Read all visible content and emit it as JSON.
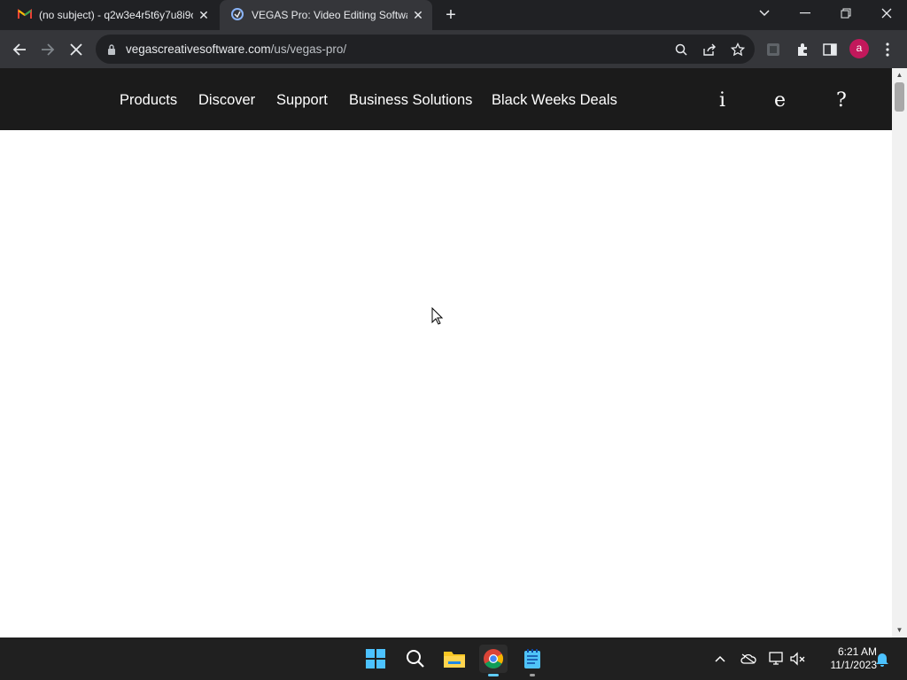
{
  "browser": {
    "tabs": [
      {
        "title": "(no subject) - q2w3e4r5t6y7u8i9o",
        "icon": "gmail-icon",
        "active": false
      },
      {
        "title": "VEGAS Pro: Video Editing Software",
        "icon": "vegas-icon",
        "active": true
      }
    ],
    "new_tab": "+",
    "url_host": "vegascreativesoftware.com",
    "url_path": "/us/vegas-pro/",
    "profile_initial": "a"
  },
  "site": {
    "nav": [
      "Products",
      "Discover",
      "Support",
      "Business Solutions",
      "Black Weeks Deals"
    ],
    "glyphs": [
      "i",
      "e",
      "?"
    ]
  },
  "taskbar": {
    "time": "6:21 AM",
    "date": "11/1/2023"
  },
  "colors": {
    "chrome_dark": "#202124",
    "toolbar": "#35363a",
    "site_nav": "#1b1b1b",
    "accent": "#60cdff"
  }
}
